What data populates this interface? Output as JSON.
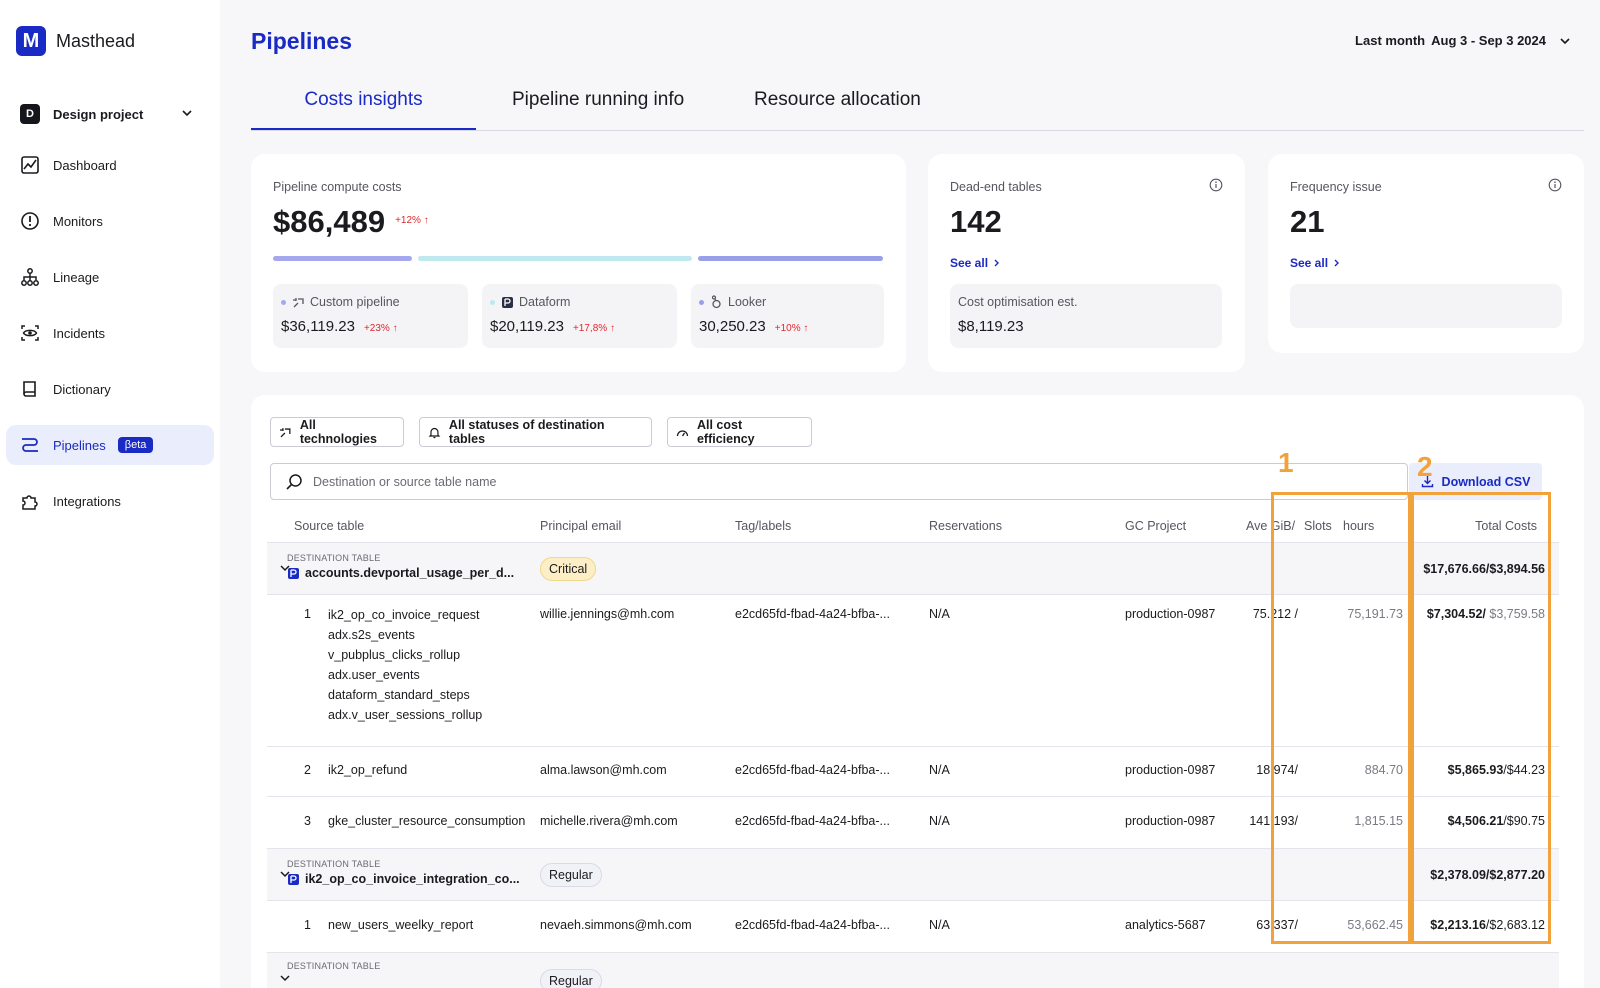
{
  "brand": {
    "logo_letter": "M",
    "name": "Masthead"
  },
  "project": {
    "badge": "D",
    "name": "Design project"
  },
  "nav": [
    {
      "label": "Dashboard",
      "icon": "chart-icon",
      "active": false
    },
    {
      "label": "Monitors",
      "icon": "alert-circle-icon",
      "active": false
    },
    {
      "label": "Lineage",
      "icon": "lineage-icon",
      "active": false
    },
    {
      "label": "Incidents",
      "icon": "eye-icon",
      "active": false
    },
    {
      "label": "Dictionary",
      "icon": "book-icon",
      "active": false
    },
    {
      "label": "Pipelines",
      "icon": "pipelines-icon",
      "active": true,
      "badge": "βeta"
    },
    {
      "label": "Integrations",
      "icon": "puzzle-icon",
      "active": false
    }
  ],
  "header": {
    "title": "Pipelines",
    "range_label": "Last month",
    "range_value": "Aug 3 - Sep 3 2024"
  },
  "tabs": [
    {
      "label": "Costs insights",
      "active": true
    },
    {
      "label": "Pipeline running info",
      "active": false
    },
    {
      "label": "Resource allocation",
      "active": false
    }
  ],
  "compute_card": {
    "label": "Pipeline compute costs",
    "value": "$86,489",
    "delta": "+12%",
    "items": [
      {
        "label": "Custom pipeline",
        "value": "$36,119.23",
        "delta": "+23%",
        "dot_color": "#a5a8ee"
      },
      {
        "label": "Dataform",
        "value": "$20,119.23",
        "delta": "+17,8%",
        "dot_color": "#bfe9ee"
      },
      {
        "label": "Looker",
        "value": "30,250.23",
        "delta": "+10%",
        "dot_color": "#9aa0e8"
      }
    ]
  },
  "dead_end_card": {
    "label": "Dead-end tables",
    "value": "142",
    "link": "See all",
    "sub_label": "Cost optimisation est.",
    "sub_value": "$8,119.23"
  },
  "frequency_card": {
    "label": "Frequency issue",
    "value": "21",
    "link": "See all"
  },
  "filters": [
    "All technologies",
    "All statuses of destination tables",
    "All cost efficiency"
  ],
  "search": {
    "placeholder": "Destination or source table name"
  },
  "download": {
    "label": "Download CSV"
  },
  "columns": {
    "source": "Source table",
    "email": "Principal email",
    "tags": "Tag/labels",
    "reservations": "Reservations",
    "project": "GC Project",
    "ave_gib": "Ave GiB/",
    "slots": "Slots",
    "hours": "hours",
    "total": "Total Costs"
  },
  "groups": [
    {
      "caption": "DESTINATION TABLE",
      "name": "accounts.devportal_usage_per_d...",
      "tag": "Critical",
      "total_bold": "$17,676.66/$3,894.56",
      "rows": [
        {
          "n": "1",
          "sources": [
            "ik2_op_co_invoice_request",
            "adx.s2s_events",
            "v_pubplus_clicks_rollup",
            "adx.user_events",
            "dataform_standard_steps",
            "adx.v_user_sessions_rollup"
          ],
          "email": "willie.jennings@mh.com",
          "tag": "e2cd65fd-fbad-4a24-bfba-...",
          "res": "N/A",
          "proj": "production-0987",
          "gib": "75.212 /",
          "slots": "75,191.73",
          "total_a": "$7,304.52/",
          "total_b": "$3,759.58"
        },
        {
          "n": "2",
          "sources": [
            "ik2_op_refund"
          ],
          "email": "alma.lawson@mh.com",
          "tag": "e2cd65fd-fbad-4a24-bfba-...",
          "res": "N/A",
          "proj": "production-0987",
          "gib": "18.974/",
          "slots": "884.70",
          "total_a": "$5,865.93",
          "total_b": "/$44.23"
        },
        {
          "n": "3",
          "sources": [
            "gke_cluster_resource_consumption"
          ],
          "email": "michelle.rivera@mh.com",
          "tag": "e2cd65fd-fbad-4a24-bfba-...",
          "res": "N/A",
          "proj": "production-0987",
          "gib": "141.193/",
          "slots": "1,815.15",
          "total_a": "$4,506.21",
          "total_b": "/$90.75"
        }
      ]
    },
    {
      "caption": "DESTINATION TABLE",
      "name": "ik2_op_co_invoice_integration_co...",
      "tag": "Regular",
      "total_bold": "$2,378.09/$2,877.20",
      "rows": [
        {
          "n": "1",
          "sources": [
            "new_users_weelky_report"
          ],
          "email": "nevaeh.simmons@mh.com",
          "tag": "e2cd65fd-fbad-4a24-bfba-...",
          "res": "N/A",
          "proj": "analytics-5687",
          "gib": "63.337/",
          "slots": "53,662.45",
          "total_a": "$2,213.16",
          "total_b": "/$2,683.12"
        }
      ]
    },
    {
      "caption": "DESTINATION TABLE",
      "tag": "Regular"
    }
  ],
  "annotations": [
    "1",
    "2"
  ],
  "colors": {
    "accent": "#1a2ac4",
    "danger": "#e0282e",
    "annotation": "#f2a23a"
  }
}
